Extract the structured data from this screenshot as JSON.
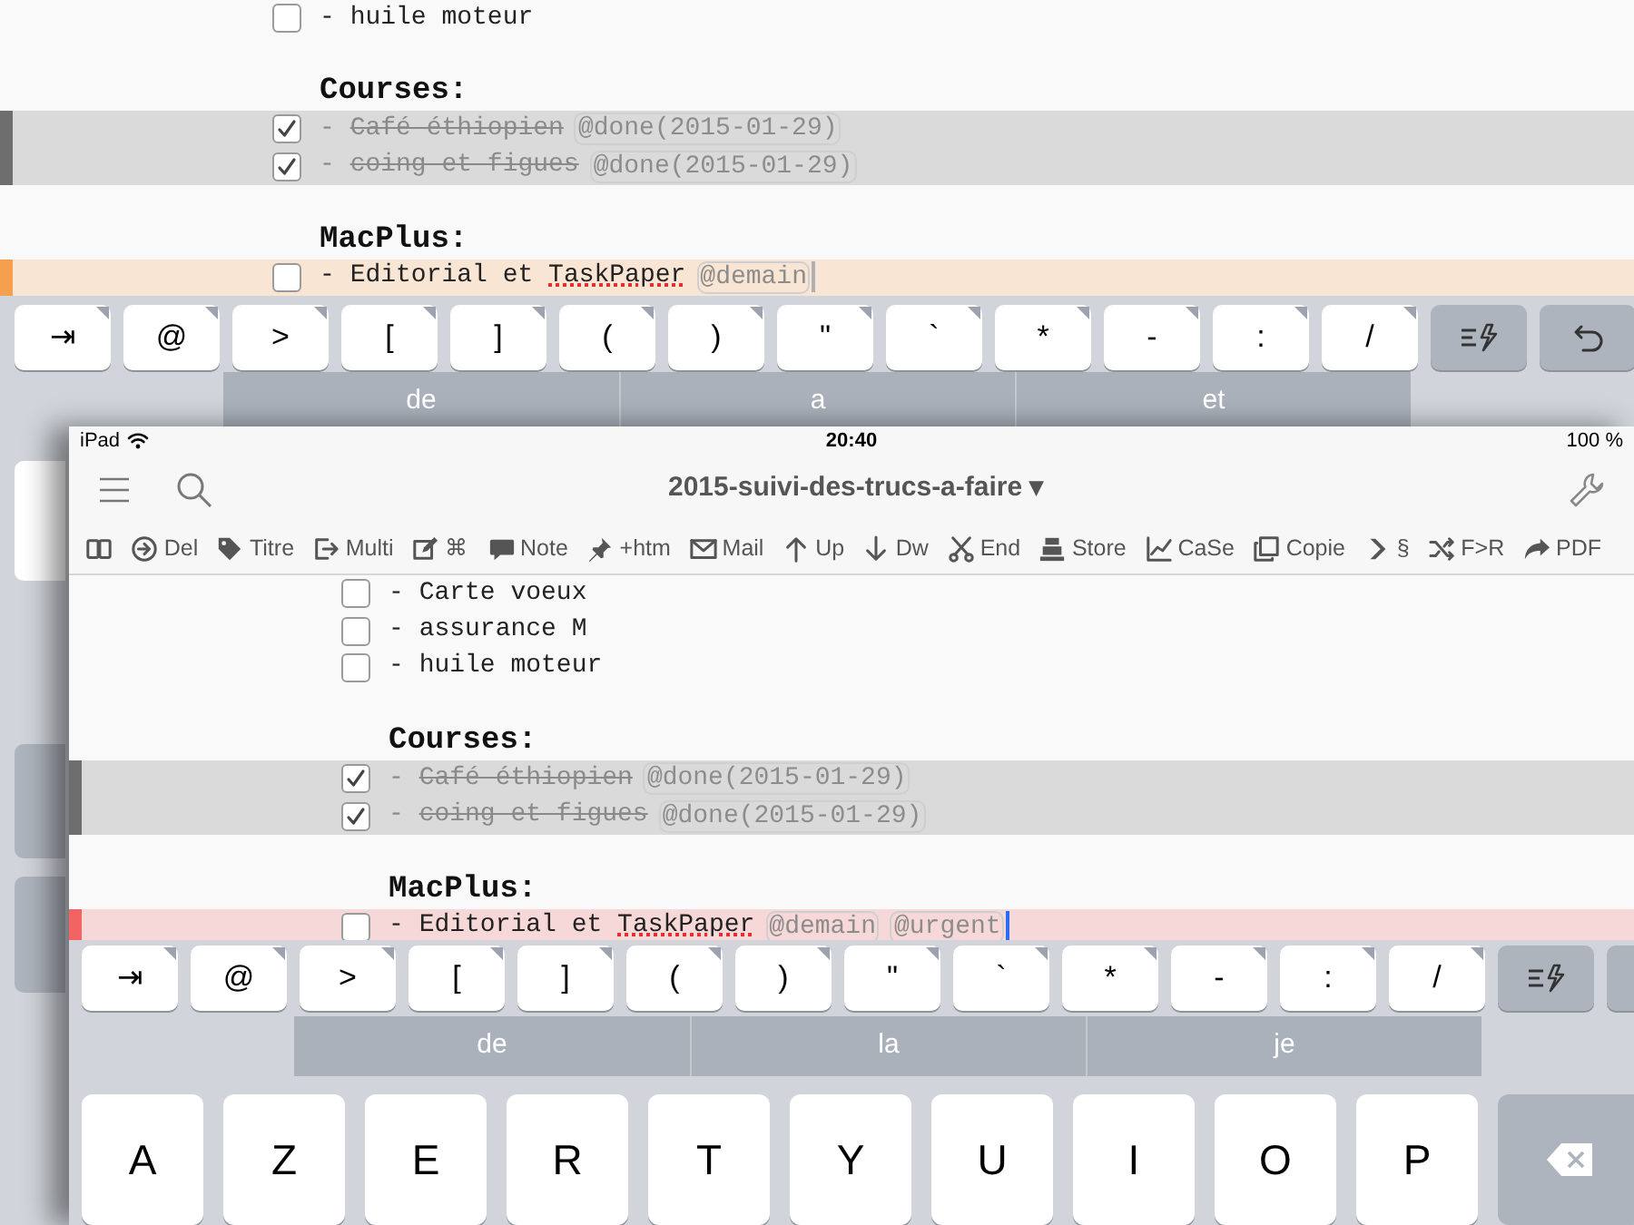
{
  "back_screen": {
    "focused": false,
    "rows": [
      {
        "kind": "task",
        "checked": false,
        "bullet": "-",
        "segments": [
          {
            "text": "huile moteur",
            "misspelled": false
          }
        ],
        "tags": [],
        "cursor": false
      },
      {
        "kind": "blank"
      },
      {
        "kind": "project",
        "text": "Courses:"
      },
      {
        "kind": "task",
        "checked": true,
        "bullet": "-",
        "segments": [
          {
            "text": "Café éthiopien",
            "misspelled": false
          }
        ],
        "tags": [
          "@done(2015-01-29)"
        ],
        "color": "#6e6e6e",
        "cursor": false
      },
      {
        "kind": "task",
        "checked": true,
        "bullet": "-",
        "segments": [
          {
            "text": "coing et figues",
            "misspelled": false
          }
        ],
        "tags": [
          "@done(2015-01-29)"
        ],
        "color": "#6e6e6e",
        "cursor": false
      },
      {
        "kind": "blank"
      },
      {
        "kind": "project",
        "text": "MacPlus:"
      },
      {
        "kind": "task",
        "checked": false,
        "bullet": "-",
        "segments": [
          {
            "text": "Editorial et",
            "misspelled": false
          },
          {
            "text": "TaskPaper",
            "misspelled": true
          }
        ],
        "tags": [
          "@demain"
        ],
        "color": "#f5a04e",
        "cursor": true
      }
    ],
    "accessory_keys": [
      {
        "kind": "char",
        "label": "⇥"
      },
      {
        "kind": "char",
        "label": "@"
      },
      {
        "kind": "char",
        "label": ">"
      },
      {
        "kind": "char",
        "label": "["
      },
      {
        "kind": "char",
        "label": "]"
      },
      {
        "kind": "char",
        "label": "("
      },
      {
        "kind": "char",
        "label": ")"
      },
      {
        "kind": "char",
        "label": "\""
      },
      {
        "kind": "char",
        "label": "`"
      },
      {
        "kind": "char",
        "label": "*"
      },
      {
        "kind": "char",
        "label": "-"
      },
      {
        "kind": "char",
        "label": ":"
      },
      {
        "kind": "char",
        "label": "/"
      },
      {
        "kind": "snippet"
      },
      {
        "kind": "undo"
      }
    ],
    "suggestions": [
      "de",
      "a",
      "et"
    ]
  },
  "front_window": {
    "focused": true,
    "status_bar": {
      "device": "iPad",
      "time": "20:40",
      "battery": "100 %"
    },
    "title": "2015-suivi-des-trucs-a-faire",
    "title_caret": "▾",
    "toolbar": [
      {
        "kind": "book"
      },
      {
        "kind": "circle-arrow",
        "label": "Del"
      },
      {
        "kind": "tag",
        "label": "Titre"
      },
      {
        "kind": "exit",
        "label": "Multi"
      },
      {
        "kind": "pencil",
        "label": "⌘"
      },
      {
        "kind": "speech",
        "label": "Note"
      },
      {
        "kind": "pin",
        "label": "+htm"
      },
      {
        "kind": "envelope",
        "label": "Mail"
      },
      {
        "kind": "arrow-up",
        "label": "Up"
      },
      {
        "kind": "arrow-down",
        "label": "Dw"
      },
      {
        "kind": "scissors",
        "label": "End"
      },
      {
        "kind": "register",
        "label": "Store"
      },
      {
        "kind": "chart",
        "label": "CaSe"
      },
      {
        "kind": "copy",
        "label": "Copie"
      },
      {
        "kind": "chevron",
        "label": "§"
      },
      {
        "kind": "shuffle",
        "label": "F>R"
      },
      {
        "kind": "share",
        "label": "PDF"
      }
    ],
    "rows": [
      {
        "kind": "task",
        "checked": false,
        "bullet": "-",
        "segments": [
          {
            "text": "Carte voeux",
            "misspelled": false
          }
        ],
        "tags": [],
        "cursor": false
      },
      {
        "kind": "task",
        "checked": false,
        "bullet": "-",
        "segments": [
          {
            "text": "assurance M",
            "misspelled": false
          }
        ],
        "tags": [],
        "cursor": false
      },
      {
        "kind": "task",
        "checked": false,
        "bullet": "-",
        "segments": [
          {
            "text": "huile moteur",
            "misspelled": false
          }
        ],
        "tags": [],
        "cursor": false
      },
      {
        "kind": "blank"
      },
      {
        "kind": "project",
        "text": "Courses:"
      },
      {
        "kind": "task",
        "checked": true,
        "bullet": "-",
        "segments": [
          {
            "text": "Café éthiopien",
            "misspelled": false
          }
        ],
        "tags": [
          "@done(2015-01-29)"
        ],
        "color": "#6e6e6e",
        "cursor": false
      },
      {
        "kind": "task",
        "checked": true,
        "bullet": "-",
        "segments": [
          {
            "text": "coing et figues",
            "misspelled": false
          }
        ],
        "tags": [
          "@done(2015-01-29)"
        ],
        "color": "#6e6e6e",
        "cursor": false
      },
      {
        "kind": "blank"
      },
      {
        "kind": "project",
        "text": "MacPlus:"
      },
      {
        "kind": "task",
        "checked": false,
        "bullet": "-",
        "segments": [
          {
            "text": "Editorial et",
            "misspelled": false
          },
          {
            "text": "TaskPaper",
            "misspelled": true
          }
        ],
        "tags": [
          "@demain",
          "@urgent"
        ],
        "color": "#f26464",
        "cursor": true
      }
    ],
    "accessory_keys": [
      {
        "kind": "char",
        "label": "⇥"
      },
      {
        "kind": "char",
        "label": "@"
      },
      {
        "kind": "char",
        "label": ">"
      },
      {
        "kind": "char",
        "label": "["
      },
      {
        "kind": "char",
        "label": "]"
      },
      {
        "kind": "char",
        "label": "("
      },
      {
        "kind": "char",
        "label": ")"
      },
      {
        "kind": "char",
        "label": "\""
      },
      {
        "kind": "char",
        "label": "`"
      },
      {
        "kind": "char",
        "label": "*"
      },
      {
        "kind": "char",
        "label": "-"
      },
      {
        "kind": "char",
        "label": ":"
      },
      {
        "kind": "char",
        "label": "/"
      },
      {
        "kind": "snippet"
      },
      {
        "kind": "plain"
      }
    ],
    "suggestions": [
      "de",
      "la",
      "je"
    ],
    "keys": [
      "A",
      "Z",
      "E",
      "R",
      "T",
      "Y",
      "U",
      "I",
      "O",
      "P"
    ]
  }
}
